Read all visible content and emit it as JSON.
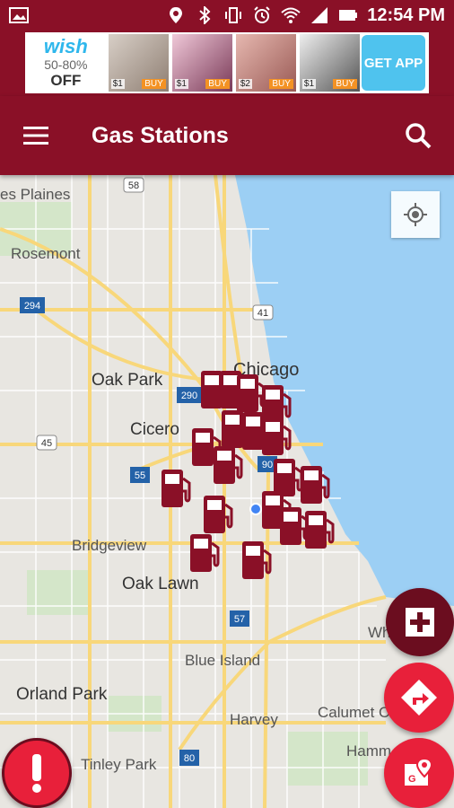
{
  "status_bar": {
    "time": "12:54 PM"
  },
  "ad": {
    "brand": "wish",
    "discount": "50-80%",
    "off_label": "OFF",
    "products": [
      {
        "price": "$1",
        "buy": "BUY"
      },
      {
        "price": "$1",
        "buy": "BUY"
      },
      {
        "price": "$2",
        "buy": "BUY"
      },
      {
        "price": "$1",
        "buy": "BUY"
      }
    ],
    "cta": "GET APP"
  },
  "app_bar": {
    "title": "Gas Stations"
  },
  "map": {
    "labels": [
      {
        "text": "es Plaines",
        "kind": "place"
      },
      {
        "text": "Rosemont",
        "kind": "place"
      },
      {
        "text": "Oak Park",
        "kind": "city"
      },
      {
        "text": "Chicago",
        "kind": "big"
      },
      {
        "text": "Cicero",
        "kind": "city"
      },
      {
        "text": "Bridgeview",
        "kind": "place"
      },
      {
        "text": "Oak Lawn",
        "kind": "city"
      },
      {
        "text": "Blue Island",
        "kind": "place"
      },
      {
        "text": "Orland Park",
        "kind": "city"
      },
      {
        "text": "Harvey",
        "kind": "place"
      },
      {
        "text": "Calumet C",
        "kind": "place"
      },
      {
        "text": "Tinley Park",
        "kind": "place"
      },
      {
        "text": "Hamm",
        "kind": "place"
      },
      {
        "text": "Wh",
        "kind": "place"
      }
    ],
    "shields": [
      "58",
      "294",
      "41",
      "290",
      "45",
      "55",
      "90",
      "57",
      "80"
    ],
    "marker_color": "#8a1027"
  },
  "colors": {
    "primary": "#8a1027",
    "dark_primary": "#6b0d1f",
    "accent": "#e8203a",
    "water": "#9ccff4",
    "land": "#e8e6e1"
  },
  "icons": {
    "menu": "menu-icon",
    "search": "search-icon",
    "my_location": "my-location-icon",
    "add": "plus-icon",
    "directions": "directions-icon",
    "map_pin": "map-pin-icon",
    "alert": "alert-icon",
    "gas_marker": "gas-pump-icon"
  }
}
